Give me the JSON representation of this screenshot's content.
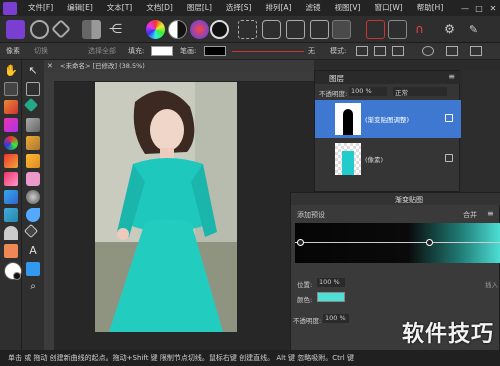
{
  "menu": {
    "items": [
      "文件[F]",
      "编辑[E]",
      "文本[T]",
      "文档[D]",
      "图层[L]",
      "选择[S]",
      "排列[A]",
      "滤镜",
      "视图[V]",
      "窗口[W]",
      "帮助[H]"
    ],
    "window_controls": [
      "—",
      "□",
      "✕"
    ]
  },
  "context_bar": {
    "label1": "像素",
    "label2": "切换",
    "label3": "选择全部",
    "fill_label": "填充:",
    "stroke_label": "笔画:",
    "none_label": "无",
    "mode_label": "模式:"
  },
  "document": {
    "tab_title": "<未命名> [已修改] (38.5%)"
  },
  "layers_panel": {
    "title": "图层",
    "opacity_label": "不透明度:",
    "opacity_value": "100 %",
    "blend_mode": "正常",
    "layers": [
      {
        "name": "(渐变贴图调整)",
        "selected": true
      },
      {
        "name": "(像素)",
        "selected": false
      }
    ]
  },
  "gradient_panel": {
    "title": "渐变贴图",
    "add_preset": "添加预设",
    "merge_button": "合并",
    "position_label": "位置:",
    "position_value": "100 %",
    "insert_label": "插入",
    "color_label": "颜色:",
    "opacity_label": "不透明度:",
    "opacity_value": "100 %",
    "color_value": "#4ee0d6"
  },
  "status": {
    "text": "单击 或 拖动 创建新曲线的起点。拖动+Shift 键 限制节点切线。鼠标右键 创建直线。 Alt 键 忽略吸附。Ctrl 键"
  },
  "watermark": "软件技巧",
  "colors": {
    "accent": "#3f78d0",
    "teal_dress": "#20c9bd",
    "primary_color": "#ffffff",
    "secondary_color": "#111111"
  }
}
